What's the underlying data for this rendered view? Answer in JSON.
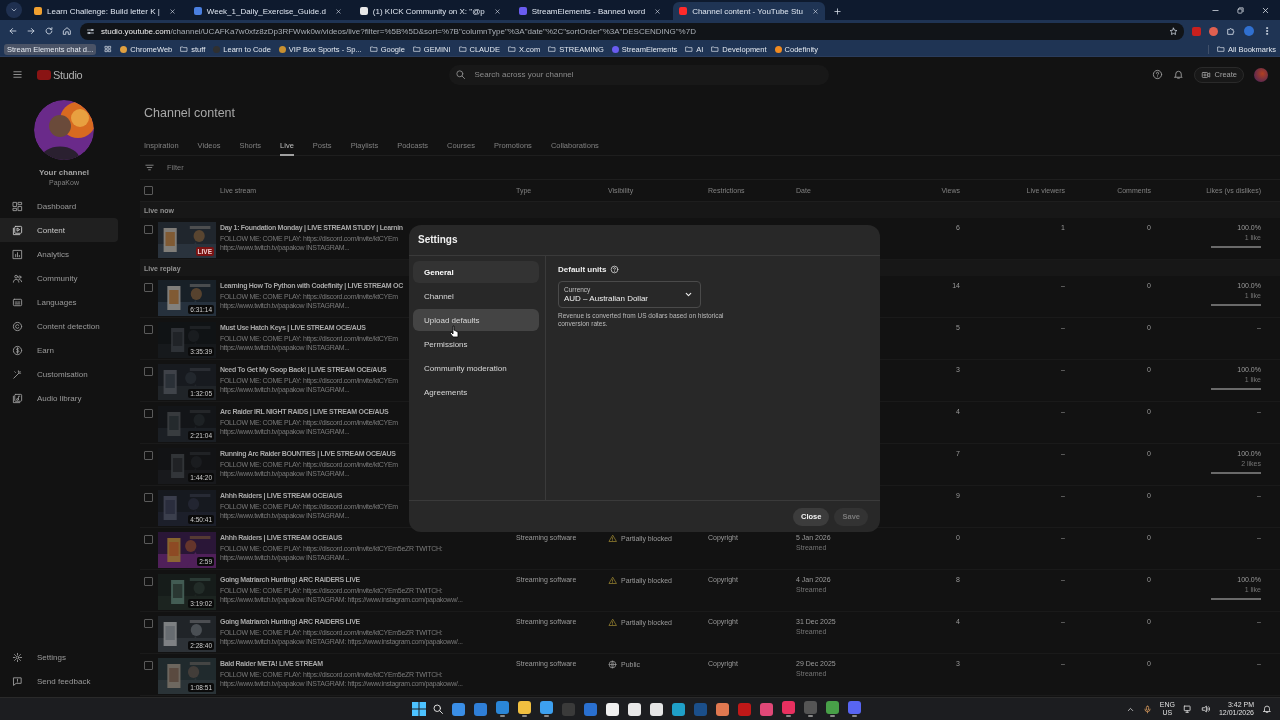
{
  "browser": {
    "tabs": [
      {
        "title": "Learn Challenge: Build letter K |",
        "color": "#f0a030",
        "selected": false
      },
      {
        "title": "Week_1_Daily_Exercise_Guide.d",
        "color": "#4a7fe0",
        "selected": false
      },
      {
        "title": "(1) KICK Community on X: \"@p",
        "color": "#e8e8e8",
        "selected": false
      },
      {
        "title": "StreamElements - Banned word",
        "color": "#6a5cf0",
        "selected": false
      },
      {
        "title": "Channel content - YouTube Stu",
        "color": "#ff2a2a",
        "selected": true
      }
    ],
    "address": {
      "host": "studio.youtube.com",
      "path": "/channel/UCAFKa7w0xfz8zDp3RFWwk0w/videos/live?filter=%5B%5D&sort=%7B\"columnType\"%3A\"date\"%2C\"sortOrder\"%3A\"DESCENDING\"%7D"
    },
    "bookmarks": [
      {
        "label": "Stream Elements chat d...",
        "kind": "pinned"
      },
      {
        "label": "ChromeWeb",
        "kind": "site",
        "color": "#e0a040"
      },
      {
        "label": "stuff",
        "kind": "folder"
      },
      {
        "label": "Learn to Code",
        "kind": "site",
        "color": "#303030"
      },
      {
        "label": "VIP Box Sports - Sp...",
        "kind": "site",
        "color": "#c89030"
      },
      {
        "label": "Google",
        "kind": "folder"
      },
      {
        "label": "GEMINI",
        "kind": "folder"
      },
      {
        "label": "CLAUDE",
        "kind": "folder"
      },
      {
        "label": "X.com",
        "kind": "folder"
      },
      {
        "label": "STREAMING",
        "kind": "folder"
      },
      {
        "label": "StreamElements",
        "kind": "site",
        "color": "#6a5cf0"
      },
      {
        "label": "AI",
        "kind": "folder"
      },
      {
        "label": "Development",
        "kind": "folder"
      },
      {
        "label": "Codefinity",
        "kind": "site",
        "color": "#f08a20"
      }
    ],
    "all_bookmarks": "All Bookmarks"
  },
  "studio": {
    "logo": "Studio",
    "search": {
      "placeholder": "Search across your channel"
    },
    "create": "Create",
    "channel": {
      "title": "Your channel",
      "handle": "PapaKow"
    },
    "nav": [
      {
        "label": "Dashboard",
        "selected": false
      },
      {
        "label": "Content",
        "selected": true
      },
      {
        "label": "Analytics",
        "selected": false
      },
      {
        "label": "Community",
        "selected": false
      },
      {
        "label": "Languages",
        "selected": false
      },
      {
        "label": "Content detection",
        "selected": false
      },
      {
        "label": "Earn",
        "selected": false
      },
      {
        "label": "Customisation",
        "selected": false
      },
      {
        "label": "Audio library",
        "selected": false
      }
    ],
    "footer_nav": [
      {
        "label": "Settings"
      },
      {
        "label": "Send feedback"
      }
    ]
  },
  "main": {
    "title": "Channel content",
    "tabs": [
      {
        "label": "Inspiration",
        "selected": false
      },
      {
        "label": "Videos",
        "selected": false
      },
      {
        "label": "Shorts",
        "selected": false
      },
      {
        "label": "Live",
        "selected": true
      },
      {
        "label": "Posts",
        "selected": false
      },
      {
        "label": "Playlists",
        "selected": false
      },
      {
        "label": "Podcasts",
        "selected": false
      },
      {
        "label": "Courses",
        "selected": false
      },
      {
        "label": "Promotions",
        "selected": false
      },
      {
        "label": "Collaborations",
        "selected": false
      }
    ],
    "filter": {
      "placeholder": "Filter"
    },
    "table": {
      "select_all": {
        "checked": false
      },
      "columns": [
        "Live stream",
        "Type",
        "Visibility",
        "Restrictions",
        "Date",
        "Views",
        "Live viewers",
        "Comments",
        "Likes (vs dislikes)"
      ],
      "sections": [
        {
          "label": "Live now",
          "rows": [
            {
              "checked": false,
              "badge": {
                "kind": "live",
                "label": "LIVE"
              },
              "title": "Day 1: Foundation Monday | LIVE STREAM STUDY | Learnin",
              "description": [
                "FOLLOW ME: COME PLAY: https://discord.com/invite/ktCYEm",
                "https://www.twitch.tv/papakow INSTAGRAM..."
              ],
              "views": "6",
              "live_viewers": "1",
              "comments": "0",
              "likes": {
                "text": "100.0%",
                "count": "1 like",
                "level": 1
              }
            }
          ]
        },
        {
          "label": "Live replay",
          "rows": [
            {
              "checked": false,
              "badge": {
                "kind": "duration",
                "label": "6:31:14"
              },
              "title": "Learning How To Python with Codefinity | LIVE STREAM OC",
              "description": [
                "FOLLOW ME: COME PLAY: https://discord.com/invite/ktCYEm",
                "https://www.twitch.tv/papakow INSTAGRAM..."
              ],
              "views": "14",
              "live_viewers": "–",
              "comments": "0",
              "likes": {
                "text": "100.0%",
                "count": "1 like",
                "level": 1
              }
            },
            {
              "checked": false,
              "badge": {
                "kind": "duration",
                "label": "3:35:39"
              },
              "title": "Must Use Hatch Keys | LIVE STREAM OCE/AUS",
              "description": [
                "FOLLOW ME: COME PLAY: https://discord.com/invite/ktCYEm",
                "https://www.twitch.tv/papakow INSTAGRAM..."
              ],
              "views": "5",
              "live_viewers": "–",
              "comments": "0",
              "likes": {
                "text": "–"
              }
            },
            {
              "checked": false,
              "badge": {
                "kind": "duration",
                "label": "1:32:05"
              },
              "title": "Need To Get My Goop Back! | LIVE STREAM OCE/AUS",
              "description": [
                "FOLLOW ME: COME PLAY: https://discord.com/invite/ktCYEm",
                "https://www.twitch.tv/papakow INSTAGRAM..."
              ],
              "views": "3",
              "live_viewers": "–",
              "comments": "0",
              "likes": {
                "text": "100.0%",
                "count": "1 like",
                "level": 1
              }
            },
            {
              "checked": false,
              "badge": {
                "kind": "duration",
                "label": "2:21:04"
              },
              "title": "Arc Raider IRL NIGHT RAIDS | LIVE STREAM OCE/AUS",
              "description": [
                "FOLLOW ME: COME PLAY: https://discord.com/invite/ktCYEm",
                "https://www.twitch.tv/papakow INSTAGRAM..."
              ],
              "views": "4",
              "live_viewers": "–",
              "comments": "0",
              "likes": {
                "text": "–"
              }
            },
            {
              "checked": false,
              "badge": {
                "kind": "duration",
                "label": "1:44:20"
              },
              "title": "Running Arc Raider BOUNTIES | LIVE STREAM OCE/AUS",
              "description": [
                "FOLLOW ME: COME PLAY: https://discord.com/invite/ktCYEm",
                "https://www.twitch.tv/papakow INSTAGRAM..."
              ],
              "views": "7",
              "live_viewers": "–",
              "comments": "0",
              "likes": {
                "text": "100.0%",
                "count": "2 likes",
                "level": 1
              }
            },
            {
              "checked": false,
              "badge": {
                "kind": "duration",
                "label": "4:50:41"
              },
              "title": "Ahhh Raiders | LIVE STREAM OCE/AUS",
              "description": [
                "FOLLOW ME: COME PLAY: https://discord.com/invite/ktCYEm",
                "https://www.twitch.tv/papakow INSTAGRAM..."
              ],
              "views": "9",
              "live_viewers": "–",
              "comments": "0",
              "likes": {
                "text": "–"
              }
            },
            {
              "checked": false,
              "badge": {
                "kind": "duration",
                "label": "2:59"
              },
              "title": "Ahhh Raiders | LIVE STREAM OCE/AUS",
              "description": [
                "FOLLOW ME: COME PLAY: https://discord.com/invite/ktCYEm5eZR TWITCH:",
                "https://www.twitch.tv/papakow INSTAGRAM..."
              ],
              "type": "Streaming software",
              "visibility": {
                "kind": "warning",
                "label": "Partially blocked"
              },
              "restrictions": "Copyright",
              "date": "5 Jan 2026",
              "date_note": "Streamed",
              "views": "0",
              "live_viewers": "–",
              "comments": "0",
              "likes": {
                "text": "–"
              }
            },
            {
              "checked": false,
              "badge": {
                "kind": "duration",
                "label": "3:19:02"
              },
              "title": "Going Matriarch Hunting! ARC RAIDERS LIVE",
              "description": [
                "FOLLOW ME: COME PLAY: https://discord.com/invite/ktCYEm5eZR TWITCH:",
                "https://www.twitch.tv/papakow INSTAGRAM: https://www.instagram.com/papakoww/..."
              ],
              "type": "Streaming software",
              "visibility": {
                "kind": "warning",
                "label": "Partially blocked"
              },
              "restrictions": "Copyright",
              "date": "4 Jan 2026",
              "date_note": "Streamed",
              "views": "8",
              "live_viewers": "–",
              "comments": "0",
              "likes": {
                "text": "100.0%",
                "count": "1 like",
                "level": 1
              }
            },
            {
              "checked": false,
              "badge": {
                "kind": "duration",
                "label": "2:28:40"
              },
              "title": "Going Matriarch Hunting! ARC RAIDERS LIVE",
              "description": [
                "FOLLOW ME: COME PLAY: https://discord.com/invite/ktCYEm5eZR TWITCH:",
                "https://www.twitch.tv/papakow INSTAGRAM: https://www.instagram.com/papakoww/..."
              ],
              "type": "Streaming software",
              "visibility": {
                "kind": "warning",
                "label": "Partially blocked"
              },
              "restrictions": "Copyright",
              "date": "31 Dec 2025",
              "date_note": "Streamed",
              "views": "4",
              "live_viewers": "–",
              "comments": "0",
              "likes": {
                "text": "–"
              }
            },
            {
              "checked": false,
              "badge": {
                "kind": "duration",
                "label": "1:08:51"
              },
              "title": "Bald Raider META! LIVE STREAM",
              "description": [
                "FOLLOW ME: COME PLAY: https://discord.com/invite/ktCYEm5eZR TWITCH:",
                "https://www.twitch.tv/papakow INSTAGRAM: https://www.instagram.com/papakoww/..."
              ],
              "type": "Streaming software",
              "visibility": {
                "kind": "public",
                "label": "Public"
              },
              "restrictions": "Copyright",
              "date": "29 Dec 2025",
              "date_note": "Streamed",
              "views": "3",
              "live_viewers": "–",
              "comments": "0",
              "likes": {
                "text": "–"
              }
            }
          ]
        }
      ]
    }
  },
  "settings": {
    "title": "Settings",
    "nav": [
      {
        "label": "General",
        "selected": true,
        "hovered": false
      },
      {
        "label": "Channel",
        "selected": false,
        "hovered": false
      },
      {
        "label": "Upload defaults",
        "selected": false,
        "hovered": true
      },
      {
        "label": "Permissions",
        "selected": false,
        "hovered": false
      },
      {
        "label": "Community moderation",
        "selected": false,
        "hovered": false
      },
      {
        "label": "Agreements",
        "selected": false,
        "hovered": false
      }
    ],
    "section_title": "Default units",
    "currency": {
      "label": "Currency",
      "value": "AUD – Australian Dollar"
    },
    "help_text": "Revenue is converted from US dollars based on historical conversion rates.",
    "buttons": [
      {
        "label": "Close",
        "disabled": false
      },
      {
        "label": "Save",
        "disabled": true
      }
    ]
  },
  "taskbar": {
    "apps": [
      {
        "color": "#3a8ee6",
        "running": false
      },
      {
        "color": "#2f7fd8",
        "running": false
      },
      {
        "color": "#2a86d8",
        "running": true
      },
      {
        "color": "#f2c040",
        "running": true
      },
      {
        "color": "#3da0f0",
        "running": true
      },
      {
        "color": "#3a3a3a",
        "running": false
      },
      {
        "color": "#2a70d0",
        "running": false
      },
      {
        "color": "#f0f0f0",
        "running": false
      },
      {
        "color": "#e8e8e8",
        "running": false
      },
      {
        "color": "#e6e6e6",
        "running": false
      },
      {
        "color": "#1fa0c8",
        "running": false
      },
      {
        "color": "#1b4f8a",
        "running": false
      },
      {
        "color": "#e07850",
        "running": false
      },
      {
        "color": "#c01818",
        "running": false
      },
      {
        "color": "#e04878",
        "running": false
      },
      {
        "color": "#e83060",
        "running": true
      },
      {
        "color": "#555555",
        "running": true
      },
      {
        "color": "#48a048",
        "running": true
      },
      {
        "color": "#5865f2",
        "running": true
      }
    ],
    "language": "ENG",
    "region": "US",
    "time": "3:42 PM",
    "date": "12/01/2026"
  }
}
